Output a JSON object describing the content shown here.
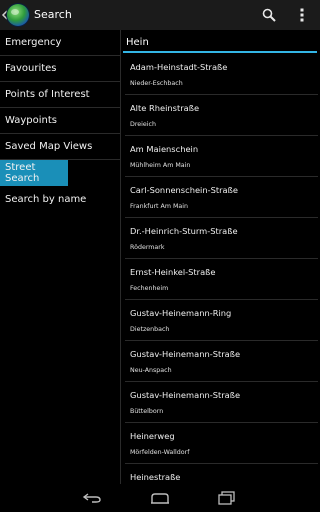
{
  "actionbar": {
    "title": "Search"
  },
  "menu": {
    "items": [
      {
        "label": "Emergency"
      },
      {
        "label": "Favourites"
      },
      {
        "label": "Points of Interest"
      },
      {
        "label": "Waypoints"
      },
      {
        "label": "Saved Map Views"
      },
      {
        "label": "Street Search"
      },
      {
        "label": "Search by name"
      }
    ],
    "selected": "Street Search"
  },
  "search": {
    "value": "Hein"
  },
  "results": [
    {
      "street": "Adam-Heinstadt-Straße",
      "city": "Nieder-Eschbach"
    },
    {
      "street": "Alte Rheinstraße",
      "city": "Dreieich"
    },
    {
      "street": "Am Maienschein",
      "city": "Mühlheim Am Main"
    },
    {
      "street": "Carl-Sonnenschein-Straße",
      "city": "Frankfurt Am Main"
    },
    {
      "street": "Dr.-Heinrich-Sturm-Straße",
      "city": "Rödermark"
    },
    {
      "street": "Ernst-Heinkel-Straße",
      "city": "Fechenheim"
    },
    {
      "street": "Gustav-Heinemann-Ring",
      "city": "Dietzenbach"
    },
    {
      "street": "Gustav-Heinemann-Straße",
      "city": "Neu-Anspach"
    },
    {
      "street": "Gustav-Heinemann-Straße",
      "city": "Büttelborn"
    },
    {
      "street": "Heinerweg",
      "city": "Mörfelden-Walldorf"
    },
    {
      "street": "Heinestraße",
      "city": ""
    }
  ],
  "colors": {
    "accent": "#33b5e5",
    "selected": "#1a8fb8",
    "actionbar": "#1b1b1b"
  },
  "icons": {
    "back": "back-caret-icon",
    "logo": "globe-icon",
    "search": "search-icon",
    "overflow": "overflow-menu-icon",
    "nav_back": "nav-back-icon",
    "nav_home": "nav-home-icon",
    "nav_recent": "nav-recent-apps-icon"
  }
}
